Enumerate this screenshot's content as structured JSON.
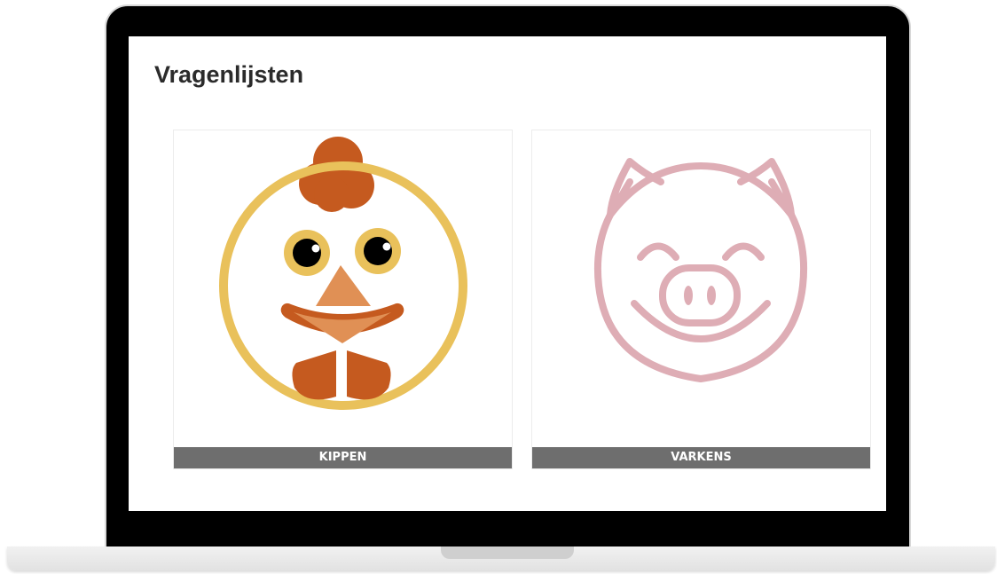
{
  "page": {
    "title": "Vragenlijsten"
  },
  "cards": [
    {
      "label": "KIPPEN",
      "icon": "chicken-icon",
      "colors": {
        "ring": "#e9c15b",
        "comb": "#c55a1f",
        "beak_upper": "#e09055",
        "beak_lower": "#c55a1f"
      }
    },
    {
      "label": "VARKENS",
      "icon": "pig-icon",
      "colors": {
        "outline": "#deadb5"
      }
    }
  ],
  "colors": {
    "label_bar": "#6e6e6e",
    "title_text": "#2b2b2b"
  }
}
